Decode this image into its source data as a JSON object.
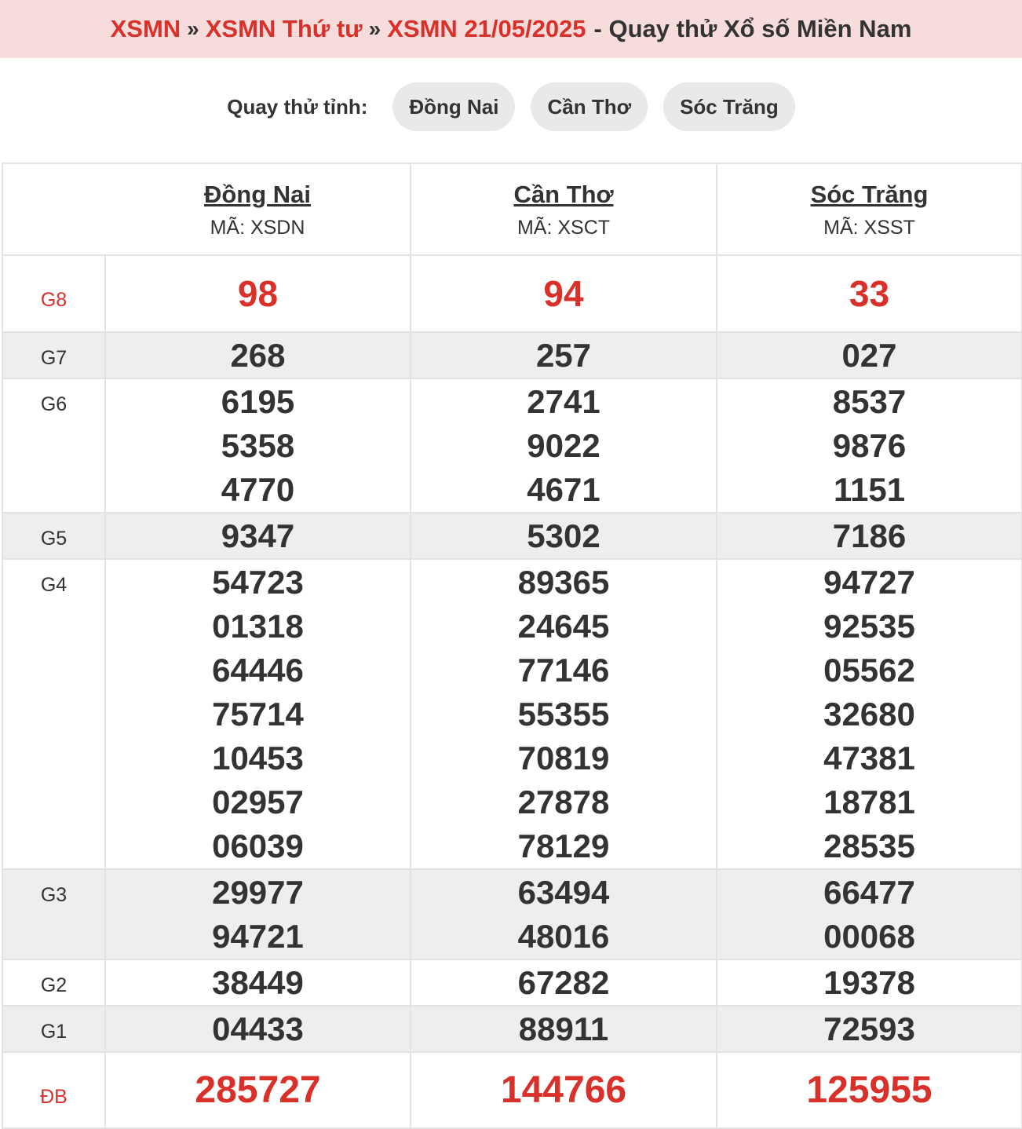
{
  "breadcrumb": {
    "item1": "XSMN",
    "item2": "XSMN Thứ tư",
    "item3": "XSMN 21/05/2025",
    "separator": "»",
    "tail": "- Quay thử Xổ số Miền Nam"
  },
  "province_bar": {
    "label": "Quay thử tỉnh:",
    "buttons": [
      "Đồng Nai",
      "Cần Thơ",
      "Sóc Trăng"
    ]
  },
  "provinces": [
    {
      "name": "Đồng Nai",
      "code": "MÃ: XSDN"
    },
    {
      "name": "Cần Thơ",
      "code": "MÃ: XSCT"
    },
    {
      "name": "Sóc Trăng",
      "code": "MÃ: XSST"
    }
  ],
  "prizes": [
    {
      "label": "G8",
      "style": "g8",
      "values": [
        [
          "98"
        ],
        [
          "94"
        ],
        [
          "33"
        ]
      ]
    },
    {
      "label": "G7",
      "style": "std shade",
      "values": [
        [
          "268"
        ],
        [
          "257"
        ],
        [
          "027"
        ]
      ]
    },
    {
      "label": "G6",
      "style": "std",
      "values": [
        [
          "6195",
          "5358",
          "4770"
        ],
        [
          "2741",
          "9022",
          "4671"
        ],
        [
          "8537",
          "9876",
          "1151"
        ]
      ]
    },
    {
      "label": "G5",
      "style": "std shade",
      "values": [
        [
          "9347"
        ],
        [
          "5302"
        ],
        [
          "7186"
        ]
      ]
    },
    {
      "label": "G4",
      "style": "std",
      "values": [
        [
          "54723",
          "01318",
          "64446",
          "75714",
          "10453",
          "02957",
          "06039"
        ],
        [
          "89365",
          "24645",
          "77146",
          "55355",
          "70819",
          "27878",
          "78129"
        ],
        [
          "94727",
          "92535",
          "05562",
          "32680",
          "47381",
          "18781",
          "28535"
        ]
      ]
    },
    {
      "label": "G3",
      "style": "std shade",
      "values": [
        [
          "29977",
          "94721"
        ],
        [
          "63494",
          "48016"
        ],
        [
          "66477",
          "00068"
        ]
      ]
    },
    {
      "label": "G2",
      "style": "std",
      "values": [
        [
          "38449"
        ],
        [
          "67282"
        ],
        [
          "19378"
        ]
      ]
    },
    {
      "label": "G1",
      "style": "std shade",
      "values": [
        [
          "04433"
        ],
        [
          "88911"
        ],
        [
          "72593"
        ]
      ]
    },
    {
      "label": "ĐB",
      "style": "db",
      "values": [
        [
          "285727"
        ],
        [
          "144766"
        ],
        [
          "125955"
        ]
      ]
    }
  ],
  "colors": {
    "accent": "#d9302a",
    "breadcrumb_bg": "#f7dcdc",
    "pill_bg": "#e9e9e9",
    "row_shade": "#eeeeee",
    "text": "#333333"
  }
}
